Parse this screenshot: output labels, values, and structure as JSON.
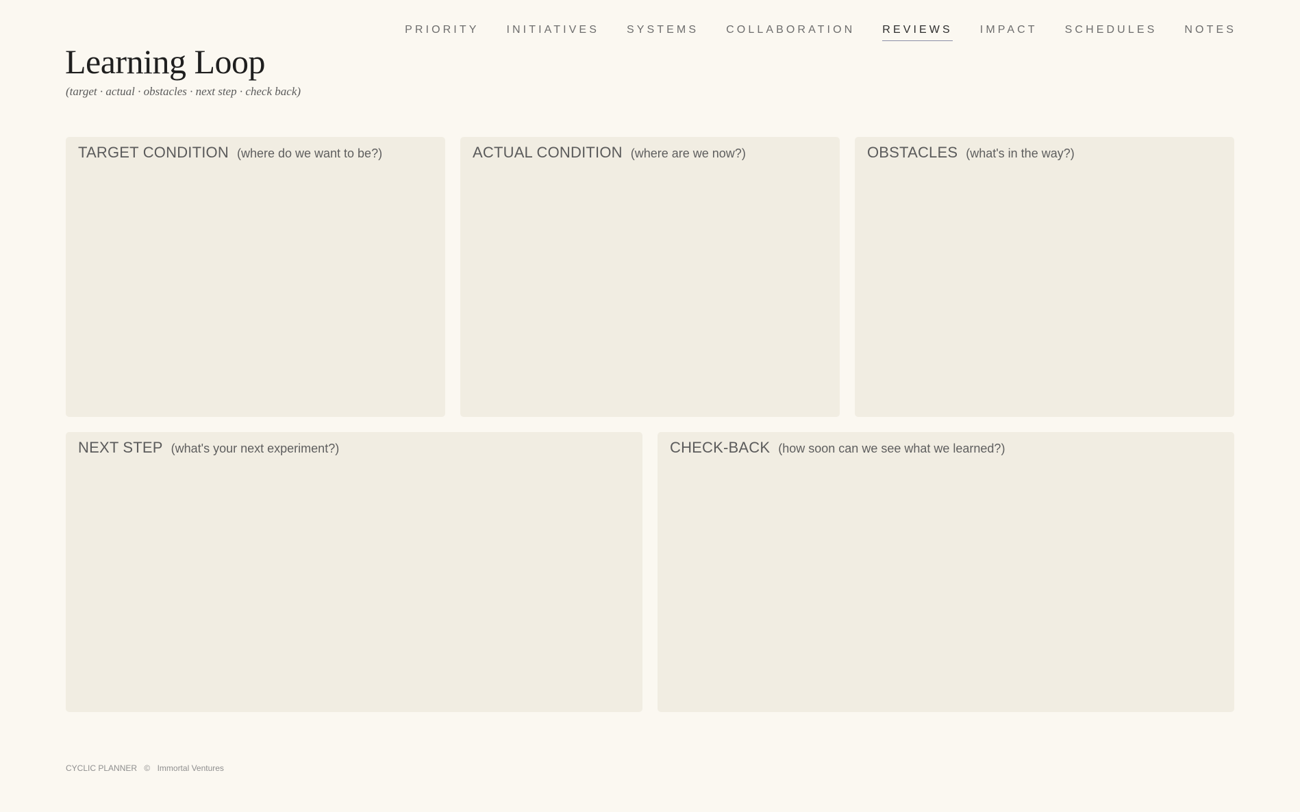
{
  "nav": {
    "items": [
      {
        "label": "PRIORITY",
        "active": false
      },
      {
        "label": "INITIATIVES",
        "active": false
      },
      {
        "label": "SYSTEMS",
        "active": false
      },
      {
        "label": "COLLABORATION",
        "active": false
      },
      {
        "label": "REVIEWS",
        "active": true
      },
      {
        "label": "IMPACT",
        "active": false
      },
      {
        "label": "SCHEDULES",
        "active": false
      },
      {
        "label": "NOTES",
        "active": false
      }
    ]
  },
  "header": {
    "title": "Learning Loop",
    "subtitle": "(target · actual · obstacles · next step · check back)"
  },
  "panels": [
    {
      "label": "TARGET CONDITION",
      "hint": "(where do we want to be?)"
    },
    {
      "label": "ACTUAL CONDITION",
      "hint": "(where are we now?)"
    },
    {
      "label": "OBSTACLES",
      "hint": "(what's in the way?)"
    },
    {
      "label": "NEXT STEP",
      "hint": "(what's your next experiment?)"
    },
    {
      "label": "CHECK-BACK",
      "hint": "(how soon can we see what we learned?)"
    }
  ],
  "footer": {
    "app_name": "CYCLIC PLANNER",
    "copyright_symbol": "©",
    "company": "Immortal Ventures"
  },
  "colors": {
    "background": "#fbf8f1",
    "panel": "#f1ede2",
    "active_underline": "#8a8ea6",
    "title_text": "#1f1f1f"
  }
}
